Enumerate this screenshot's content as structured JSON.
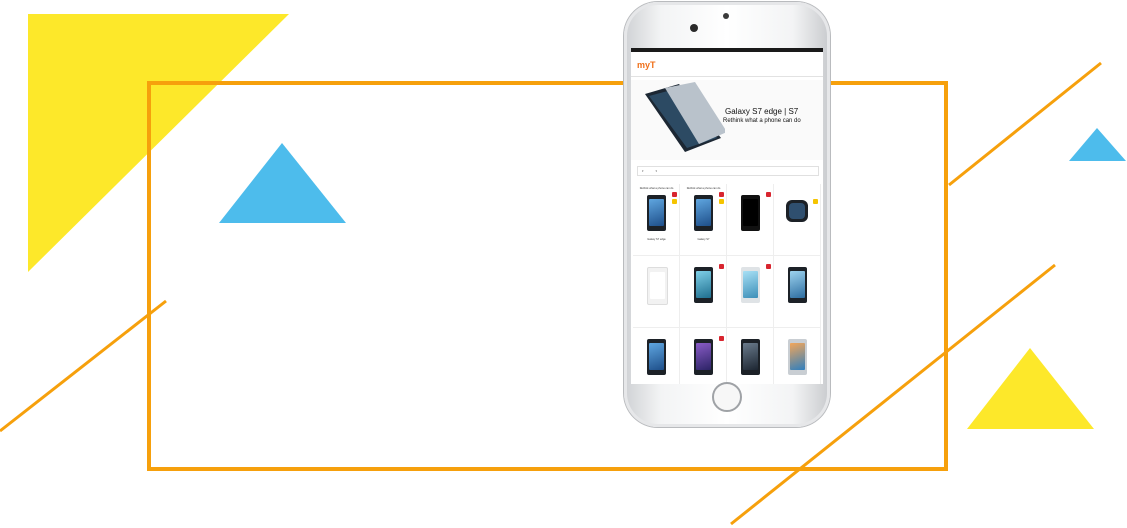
{
  "colors": {
    "frame": "#f6a00c",
    "yellow": "#fde82a",
    "blue": "#4dbcec",
    "orange_line": "#f6a00c",
    "brand_accent": "#f0701a"
  },
  "phone": {
    "app_logo": "myT",
    "banner": {
      "title": "Galaxy S7 edge | S7",
      "subtitle": "Rethink what a phone can do"
    },
    "products": [
      {
        "caption": "Rethink what a phone can do",
        "name": "Galaxy S7 edge"
      },
      {
        "caption": "Rethink what a phone can do",
        "name": "Galaxy S7"
      },
      {
        "caption": "",
        "name": ""
      },
      {
        "caption": "",
        "name": ""
      },
      {
        "caption": "",
        "name": ""
      },
      {
        "caption": "",
        "name": ""
      },
      {
        "caption": "",
        "name": ""
      },
      {
        "caption": "",
        "name": ""
      },
      {
        "caption": "",
        "name": ""
      },
      {
        "caption": "",
        "name": ""
      },
      {
        "caption": "",
        "name": ""
      },
      {
        "caption": "",
        "name": ""
      }
    ]
  }
}
